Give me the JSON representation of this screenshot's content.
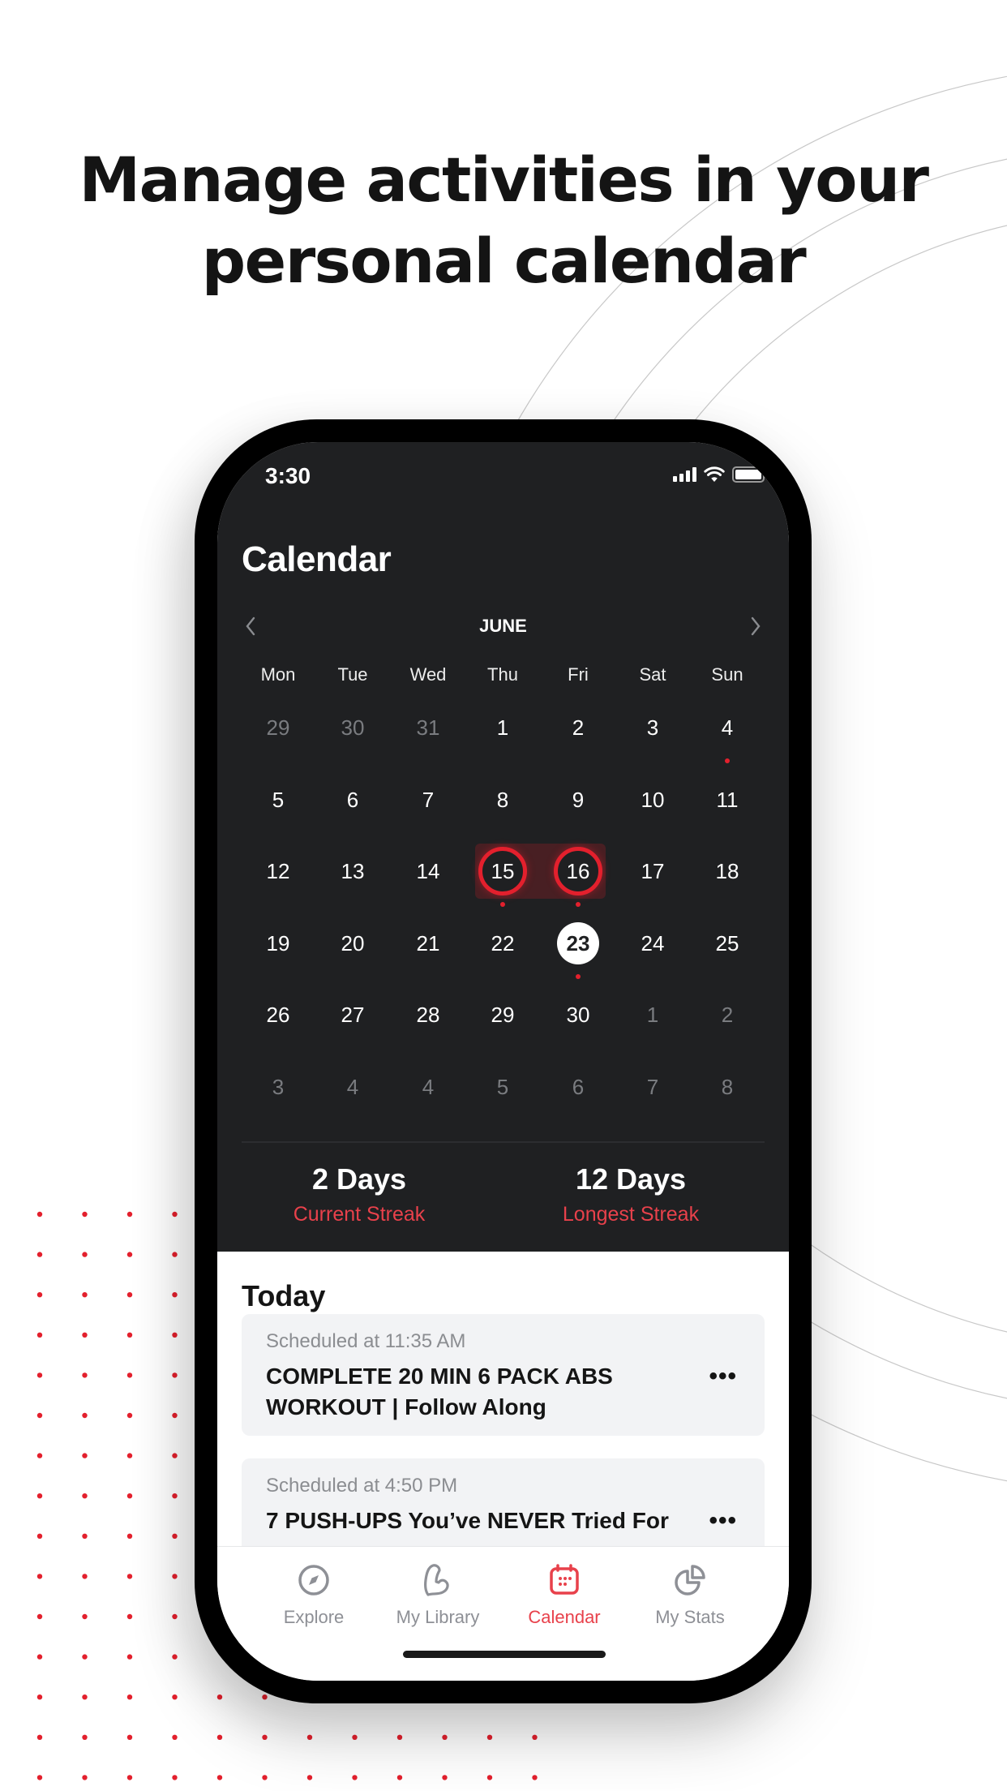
{
  "headline": {
    "line1": "Manage activities in your",
    "line2": "personal calendar"
  },
  "colors": {
    "accent": "#e3202d",
    "accent_text": "#e8414b",
    "dark_bg": "#1f2022",
    "muted_day": "#7a7c80"
  },
  "status_bar": {
    "time": "3:30",
    "icons": [
      "signal-icon",
      "wifi-icon",
      "battery-icon"
    ]
  },
  "calendar": {
    "title": "Calendar",
    "month": "JUNE",
    "prev_icon": "chevron-left-icon",
    "next_icon": "chevron-right-icon",
    "weekdays": [
      "Mon",
      "Tue",
      "Wed",
      "Thu",
      "Fri",
      "Sat",
      "Sun"
    ],
    "weeks": [
      [
        {
          "d": "29",
          "muted": true
        },
        {
          "d": "30",
          "muted": true
        },
        {
          "d": "31",
          "muted": true
        },
        {
          "d": "1"
        },
        {
          "d": "2"
        },
        {
          "d": "3"
        },
        {
          "d": "4",
          "dot": true
        }
      ],
      [
        {
          "d": "5"
        },
        {
          "d": "6"
        },
        {
          "d": "7"
        },
        {
          "d": "8"
        },
        {
          "d": "9"
        },
        {
          "d": "10"
        },
        {
          "d": "11"
        }
      ],
      [
        {
          "d": "12"
        },
        {
          "d": "13"
        },
        {
          "d": "14"
        },
        {
          "d": "15",
          "ringed": true,
          "dot": true
        },
        {
          "d": "16",
          "ringed": true,
          "dot": true
        },
        {
          "d": "17"
        },
        {
          "d": "18"
        }
      ],
      [
        {
          "d": "19"
        },
        {
          "d": "20"
        },
        {
          "d": "21"
        },
        {
          "d": "22"
        },
        {
          "d": "23",
          "today": true,
          "dot": true
        },
        {
          "d": "24"
        },
        {
          "d": "25"
        }
      ],
      [
        {
          "d": "26"
        },
        {
          "d": "27"
        },
        {
          "d": "28"
        },
        {
          "d": "29"
        },
        {
          "d": "30"
        },
        {
          "d": "1",
          "muted": true
        },
        {
          "d": "2",
          "muted": true
        }
      ],
      [
        {
          "d": "3",
          "muted": true
        },
        {
          "d": "4",
          "muted": true
        },
        {
          "d": "4",
          "muted": true
        },
        {
          "d": "5",
          "muted": true
        },
        {
          "d": "6",
          "muted": true
        },
        {
          "d": "7",
          "muted": true
        },
        {
          "d": "8",
          "muted": true
        }
      ]
    ],
    "selected_range": [
      "15",
      "16"
    ]
  },
  "streaks": {
    "current": {
      "value": "2 Days",
      "label": "Current Streak"
    },
    "longest": {
      "value": "12 Days",
      "label": "Longest Streak"
    }
  },
  "today": {
    "title": "Today",
    "items": [
      {
        "scheduled": "Scheduled at 11:35 AM",
        "name": "COMPLETE 20 MIN 6 PACK ABS WORKOUT | Follow Along",
        "more_icon": "more-horizontal-icon"
      },
      {
        "scheduled": "Scheduled at 4:50 PM",
        "name": "7 PUSH-UPS You’ve NEVER Tried For",
        "more_icon": "more-horizontal-icon"
      }
    ]
  },
  "tabbar": {
    "tabs": [
      {
        "label": "Explore",
        "icon": "compass-icon",
        "active": false
      },
      {
        "label": "My Library",
        "icon": "flexed-arm-icon",
        "active": false
      },
      {
        "label": "Calendar",
        "icon": "calendar-icon",
        "active": true
      },
      {
        "label": "My Stats",
        "icon": "pie-chart-icon",
        "active": false
      }
    ]
  }
}
